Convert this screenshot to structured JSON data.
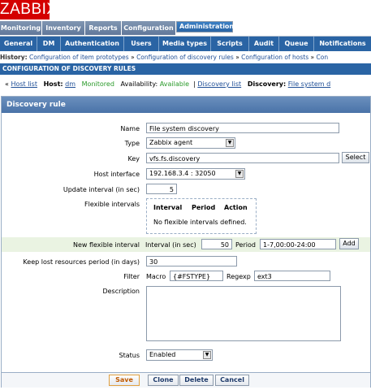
{
  "logo": "ZABBIX",
  "main_menu": [
    "Monitoring",
    "Inventory",
    "Reports",
    "Configuration",
    "Administration"
  ],
  "sub_menu": [
    "General",
    "DM",
    "Authentication",
    "Users",
    "Media types",
    "Scripts",
    "Audit",
    "Queue",
    "Notifications"
  ],
  "history": {
    "label": "History:",
    "items": [
      "Configuration of item prototypes",
      "»",
      "Configuration of discovery rules",
      "»",
      "Configuration of hosts",
      "»",
      "Con"
    ]
  },
  "page_header": "CONFIGURATION OF DISCOVERY RULES",
  "nav": {
    "host_list": "Host list",
    "host_label": "Host:",
    "host_name": "dm",
    "monitored": "Monitored",
    "availability_label": "Availability:",
    "availability_value": "Available",
    "discovery_list": "Discovery list",
    "discovery_label": "Discovery:",
    "discovery_value": "File system d"
  },
  "form": {
    "title": "Discovery rule",
    "name_label": "Name",
    "name_value": "File system discovery",
    "type_label": "Type",
    "type_value": "Zabbix agent",
    "key_label": "Key",
    "key_value": "vfs.fs.discovery",
    "select_btn": "Select",
    "host_iface_label": "Host interface",
    "host_iface_value": "192.168.3.4 : 32050",
    "update_label": "Update interval (in sec)",
    "update_value": "5",
    "flex_label": "Flexible intervals",
    "flex_headers": [
      "Interval",
      "Period",
      "Action"
    ],
    "flex_empty": "No flexible intervals defined.",
    "new_flex_label": "New flexible interval",
    "interval_label": "Interval (in sec)",
    "interval_value": "50",
    "period_label": "Period",
    "period_value": "1-7,00:00-24:00",
    "add_btn": "Add",
    "keep_label": "Keep lost resources period (in days)",
    "keep_value": "30",
    "filter_label": "Filter",
    "macro_label": "Macro",
    "macro_value": "{#FSTYPE}",
    "regexp_label": "Regexp",
    "regexp_value": "ext3",
    "desc_label": "Description",
    "status_label": "Status",
    "status_value": "Enabled"
  },
  "buttons": {
    "save": "Save",
    "clone": "Clone",
    "delete": "Delete",
    "cancel": "Cancel"
  },
  "colors": {
    "brand_red": "#d40000",
    "nav_blue": "#2a64a4",
    "link_blue": "#1e4e96",
    "ok_green": "#2a9a2a"
  }
}
